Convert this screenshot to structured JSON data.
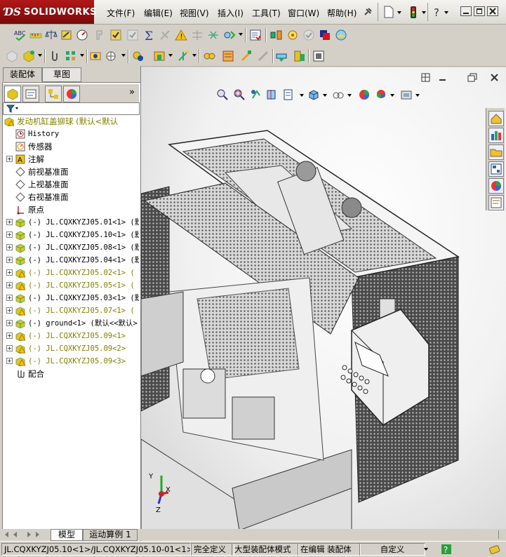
{
  "app": {
    "logo_ds": "ƊS",
    "logo_text": "SOLIDWORKS"
  },
  "menu": [
    "文件(F)",
    "编辑(E)",
    "视图(V)",
    "插入(I)",
    "工具(T)",
    "窗口(W)",
    "帮助(H)"
  ],
  "left_panel": {
    "tabs": [
      "装配体",
      "草图"
    ],
    "panel_icons": [
      "feature-manager-icon",
      "property-manager-icon",
      "configuration-manager-icon",
      "display-manager-icon"
    ],
    "more_label": "»",
    "filter_icon": "filter-icon"
  },
  "tree": [
    {
      "label": "发动机缸盖铆球  (默认<默认",
      "icon": "assembly-warning-icon",
      "indent": 0,
      "expander": "",
      "color": "#808000",
      "mono": false
    },
    {
      "label": "History",
      "icon": "history-icon",
      "indent": 1,
      "expander": "",
      "color": "#000000",
      "mono": true
    },
    {
      "label": "传感器",
      "icon": "sensor-icon",
      "indent": 1,
      "expander": "",
      "color": "#000000",
      "mono": false
    },
    {
      "label": "注解",
      "icon": "annotation-icon",
      "indent": 1,
      "expander": "+",
      "color": "#000000",
      "mono": false
    },
    {
      "label": "前视基准面",
      "icon": "plane-icon",
      "indent": 1,
      "expander": "",
      "color": "#000000",
      "mono": false
    },
    {
      "label": "上视基准面",
      "icon": "plane-icon",
      "indent": 1,
      "expander": "",
      "color": "#000000",
      "mono": false
    },
    {
      "label": "右视基准面",
      "icon": "plane-icon",
      "indent": 1,
      "expander": "",
      "color": "#000000",
      "mono": false
    },
    {
      "label": "原点",
      "icon": "origin-icon",
      "indent": 1,
      "expander": "",
      "color": "#000000",
      "mono": false
    },
    {
      "label": "(-) JL.CQXKYZJ05.01<1> (默",
      "icon": "subassembly-icon",
      "indent": 1,
      "expander": "+",
      "color": "#000000",
      "mono": true
    },
    {
      "label": "(-) JL.CQXKYZJ05.10<1> (默",
      "icon": "subassembly-icon",
      "indent": 1,
      "expander": "+",
      "color": "#000000",
      "mono": true
    },
    {
      "label": "(-) JL.CQXKYZJ05.08<1> (默",
      "icon": "subassembly-icon",
      "indent": 1,
      "expander": "+",
      "color": "#000000",
      "mono": true
    },
    {
      "label": "(-) JL.CQXKYZJ05.04<1> (默",
      "icon": "subassembly-icon",
      "indent": 1,
      "expander": "+",
      "color": "#000000",
      "mono": true
    },
    {
      "label": "(-) JL.CQXKYZJ05.02<1> (",
      "icon": "subassembly-warning-icon",
      "indent": 1,
      "expander": "+",
      "color": "#808000",
      "mono": true
    },
    {
      "label": "(-) JL.CQXKYZJ05.05<1> (",
      "icon": "subassembly-warning-icon",
      "indent": 1,
      "expander": "+",
      "color": "#808000",
      "mono": true
    },
    {
      "label": "(-) JL.CQXKYZJ05.03<1> (默",
      "icon": "subassembly-icon",
      "indent": 1,
      "expander": "+",
      "color": "#000000",
      "mono": true
    },
    {
      "label": "(-) JL.CQXKYZJ05.07<1> (",
      "icon": "subassembly-warning-icon",
      "indent": 1,
      "expander": "+",
      "color": "#808000",
      "mono": true
    },
    {
      "label": "(-) ground<1> (默认<<默认>",
      "icon": "subassembly-icon",
      "indent": 1,
      "expander": "+",
      "color": "#000000",
      "mono": true
    },
    {
      "label": "(-) JL.CQXKYZJ05.09<1>",
      "icon": "subassembly-warning-icon",
      "indent": 1,
      "expander": "+",
      "color": "#808000",
      "mono": true
    },
    {
      "label": "(-) JL.CQXKYZJ05.09<2>",
      "icon": "subassembly-warning-icon",
      "indent": 1,
      "expander": "+",
      "color": "#808000",
      "mono": true
    },
    {
      "label": "(-) JL.CQXKYZJ05.09<3>",
      "icon": "subassembly-warning-icon",
      "indent": 1,
      "expander": "+",
      "color": "#808000",
      "mono": true
    },
    {
      "label": "配合",
      "icon": "mates-icon",
      "indent": 1,
      "expander": "",
      "color": "#000000",
      "mono": false
    }
  ],
  "triad": {
    "x": "X",
    "y": "Y",
    "z": "Z"
  },
  "bottom_tabs": [
    "模型",
    "运动算例 1"
  ],
  "status": {
    "path": "JL.CQXKYZJ05.10<1>/JL.CQXKYZJ05.10-01<1>",
    "definition": "完全定义",
    "mode": "大型装配体模式",
    "editing": "在编辑 装配体",
    "units": "自定义"
  },
  "colors": {
    "logo_red": "#9a1414",
    "warning_text": "#808000",
    "panel_bg": "#d4d0c8"
  }
}
